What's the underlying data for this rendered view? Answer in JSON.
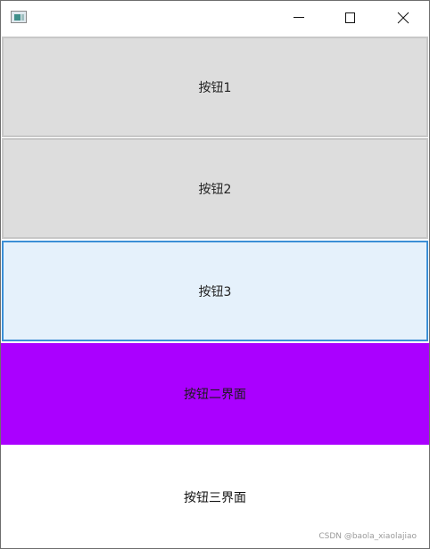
{
  "titlebar": {
    "app_icon": "window-app-icon",
    "minimize_icon": "minimize-icon",
    "maximize_icon": "maximize-icon",
    "close_icon": "close-icon"
  },
  "buttons": [
    {
      "label": "按钮1"
    },
    {
      "label": "按钮2"
    },
    {
      "label": "按钮3"
    },
    {
      "label": "按钮二界面"
    },
    {
      "label": "按钮三界面"
    }
  ],
  "watermark": "CSDN @baola_xiaolajiao",
  "colors": {
    "button_default": "#dddddd",
    "button_hover": "#e5f1fb",
    "button_hover_border": "#3c8fd6",
    "button_purple": "#aa00ff",
    "button_white": "#ffffff"
  }
}
